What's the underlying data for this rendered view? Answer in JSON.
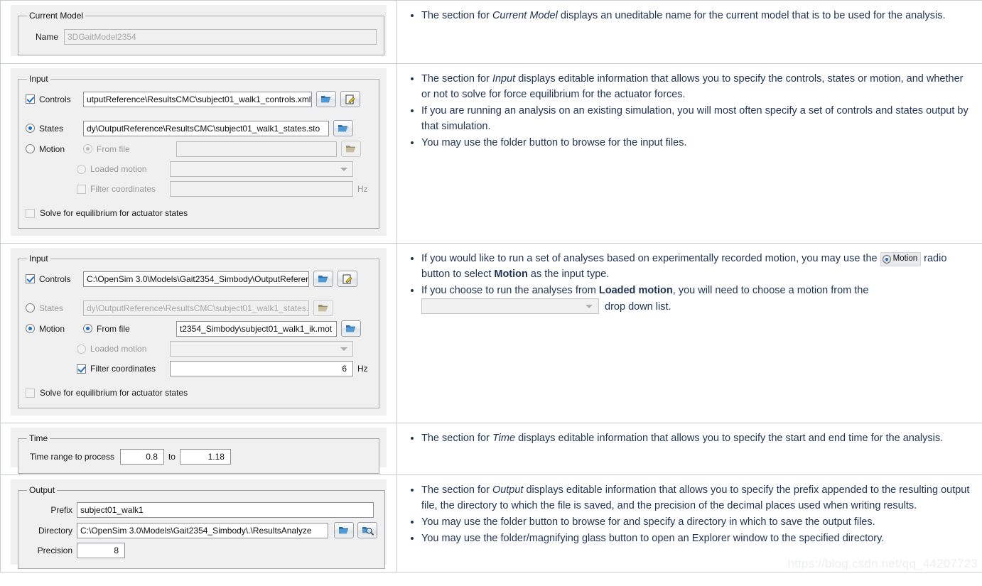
{
  "rows": [
    {
      "id": "current-model",
      "panel": {
        "legend": "Current Model",
        "name_label": "Name",
        "name_value": "3DGaitModel2354"
      },
      "notes": [
        "The section for <em>Current Model</em> displays an uneditable name for the current model that is to be used for the analysis."
      ]
    },
    {
      "id": "input-states",
      "panel": {
        "legend": "Input",
        "controls_label": "Controls",
        "controls_value": "utputReference\\ResultsCMC\\subject01_walk1_controls.xml",
        "controls_checked": true,
        "states_label": "States",
        "states_value": "dy\\OutputReference\\ResultsCMC\\subject01_walk1_states.sto",
        "states_selected": true,
        "motion_label": "Motion",
        "motion_selected": false,
        "from_file_label": "From file",
        "from_file_value": "",
        "from_file_selected": true,
        "from_file_enabled": false,
        "loaded_motion_label": "Loaded motion",
        "loaded_motion_value": "",
        "loaded_motion_selected": false,
        "filter_label": "Filter coordinates",
        "filter_checked": false,
        "filter_value": "",
        "hz_label": "Hz",
        "solve_label": "Solve for equilibrium for actuator states",
        "solve_checked": false
      },
      "notes": [
        "The section for <em>Input</em> displays editable information that allows you to specify the controls, states or motion, and whether or not to solve for force equilibrium for the actuator forces.",
        "If you are running an analysis on an existing simulation, you will most often specify a set of controls and states output by that simulation.",
        "You may use the folder button to browse for the input files."
      ]
    },
    {
      "id": "input-motion",
      "panel": {
        "legend": "Input",
        "controls_label": "Controls",
        "controls_value": "C:\\OpenSim 3.0\\Models\\Gait2354_Simbody\\OutputReferen",
        "controls_checked": true,
        "states_label": "States",
        "states_value": "dy\\OutputReference\\ResultsCMC\\subject01_walk1_states.sto",
        "states_selected": false,
        "motion_label": "Motion",
        "motion_selected": true,
        "from_file_label": "From file",
        "from_file_value": "t2354_Simbody\\subject01_walk1_ik.mot",
        "from_file_selected": true,
        "from_file_enabled": true,
        "loaded_motion_label": "Loaded motion",
        "loaded_motion_value": "",
        "loaded_motion_selected": false,
        "filter_label": "Filter coordinates",
        "filter_checked": true,
        "filter_value": "6",
        "hz_label": "Hz",
        "solve_label": "Solve for equilibrium for actuator states",
        "solve_checked": false
      },
      "notes": [
        "If you would like to run a set of analyses based on experimentally recorded motion, you may use the <span class=\"inline-motion\" data-name=\"inline-motion-radio-graphic\" data-interactable=\"false\"><span class=\"dot\"></span>Motion</span> radio button to select <b>Motion</b> as the input type.",
        "If you choose to run the analyses from <b>Loaded motion</b>, you will need to choose a motion from the <span class=\"inline-combo\" data-name=\"inline-loaded-motion-combo-graphic\" data-interactable=\"false\"><span class=\"arrow\"></span></span> drop down list."
      ]
    },
    {
      "id": "time",
      "panel": {
        "legend": "Time",
        "range_label": "Time range to process",
        "start_value": "0.8",
        "to_label": "to",
        "end_value": "1.18"
      },
      "notes": [
        "The section for <em>Time</em> displays editable information that allows you to specify the start and end time for the analysis."
      ]
    },
    {
      "id": "output",
      "panel": {
        "legend": "Output",
        "prefix_label": "Prefix",
        "prefix_value": "subject01_walk1",
        "directory_label": "Directory",
        "directory_value": "C:\\OpenSim 3.0\\Models\\Gait2354_Simbody\\.\\ResultsAnalyze",
        "precision_label": "Precision",
        "precision_value": "8"
      },
      "notes": [
        "The section for <em>Output</em> displays editable information that allows you to specify the prefix appended to the resulting output file, the directory to which the file is saved, and the precision of the decimal places used when writing results.",
        "You may use the folder button to browse for and specify a directory in which to save the output files.",
        "You may use the folder/magnifying glass button to open an Explorer window to the specified directory."
      ]
    }
  ],
  "icons": {
    "folder": "folder-open-icon",
    "edit": "edit-document-icon",
    "search_folder": "folder-magnifier-icon"
  },
  "watermark": "https://blog.csdn.net/qq_44207723"
}
